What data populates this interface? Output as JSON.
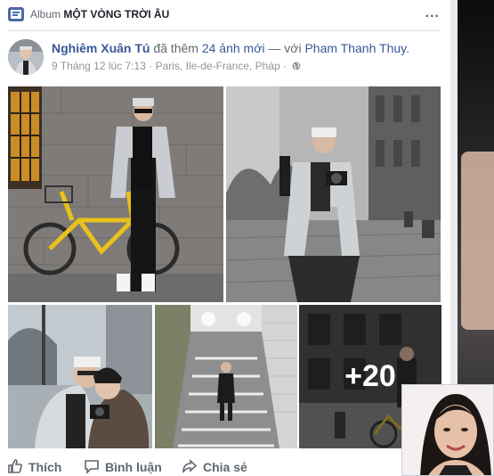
{
  "header": {
    "album_label": "Album",
    "album_name": "MỘT VÒNG TRỜI ÂU",
    "more_icon": "..."
  },
  "post": {
    "author": "Nghiêm Xuân Tú",
    "action_text": "đã thêm",
    "photos_link": "24 ảnh mới",
    "with_text": "— với",
    "tagged": "Pham Thanh Thuy",
    "end_punct": ".",
    "timestamp": "9 Tháng 12 lúc 7:13",
    "separator": "·",
    "location": "Paris, Ile-de-France, Pháp",
    "separator2": "·"
  },
  "photos": {
    "more_count": "+20"
  },
  "actions": {
    "like": "Thích",
    "comment": "Bình luận",
    "share": "Chia sẻ"
  },
  "colors": {
    "link_blue": "#385898",
    "meta_gray": "#90949c",
    "action_gray": "#606770"
  }
}
